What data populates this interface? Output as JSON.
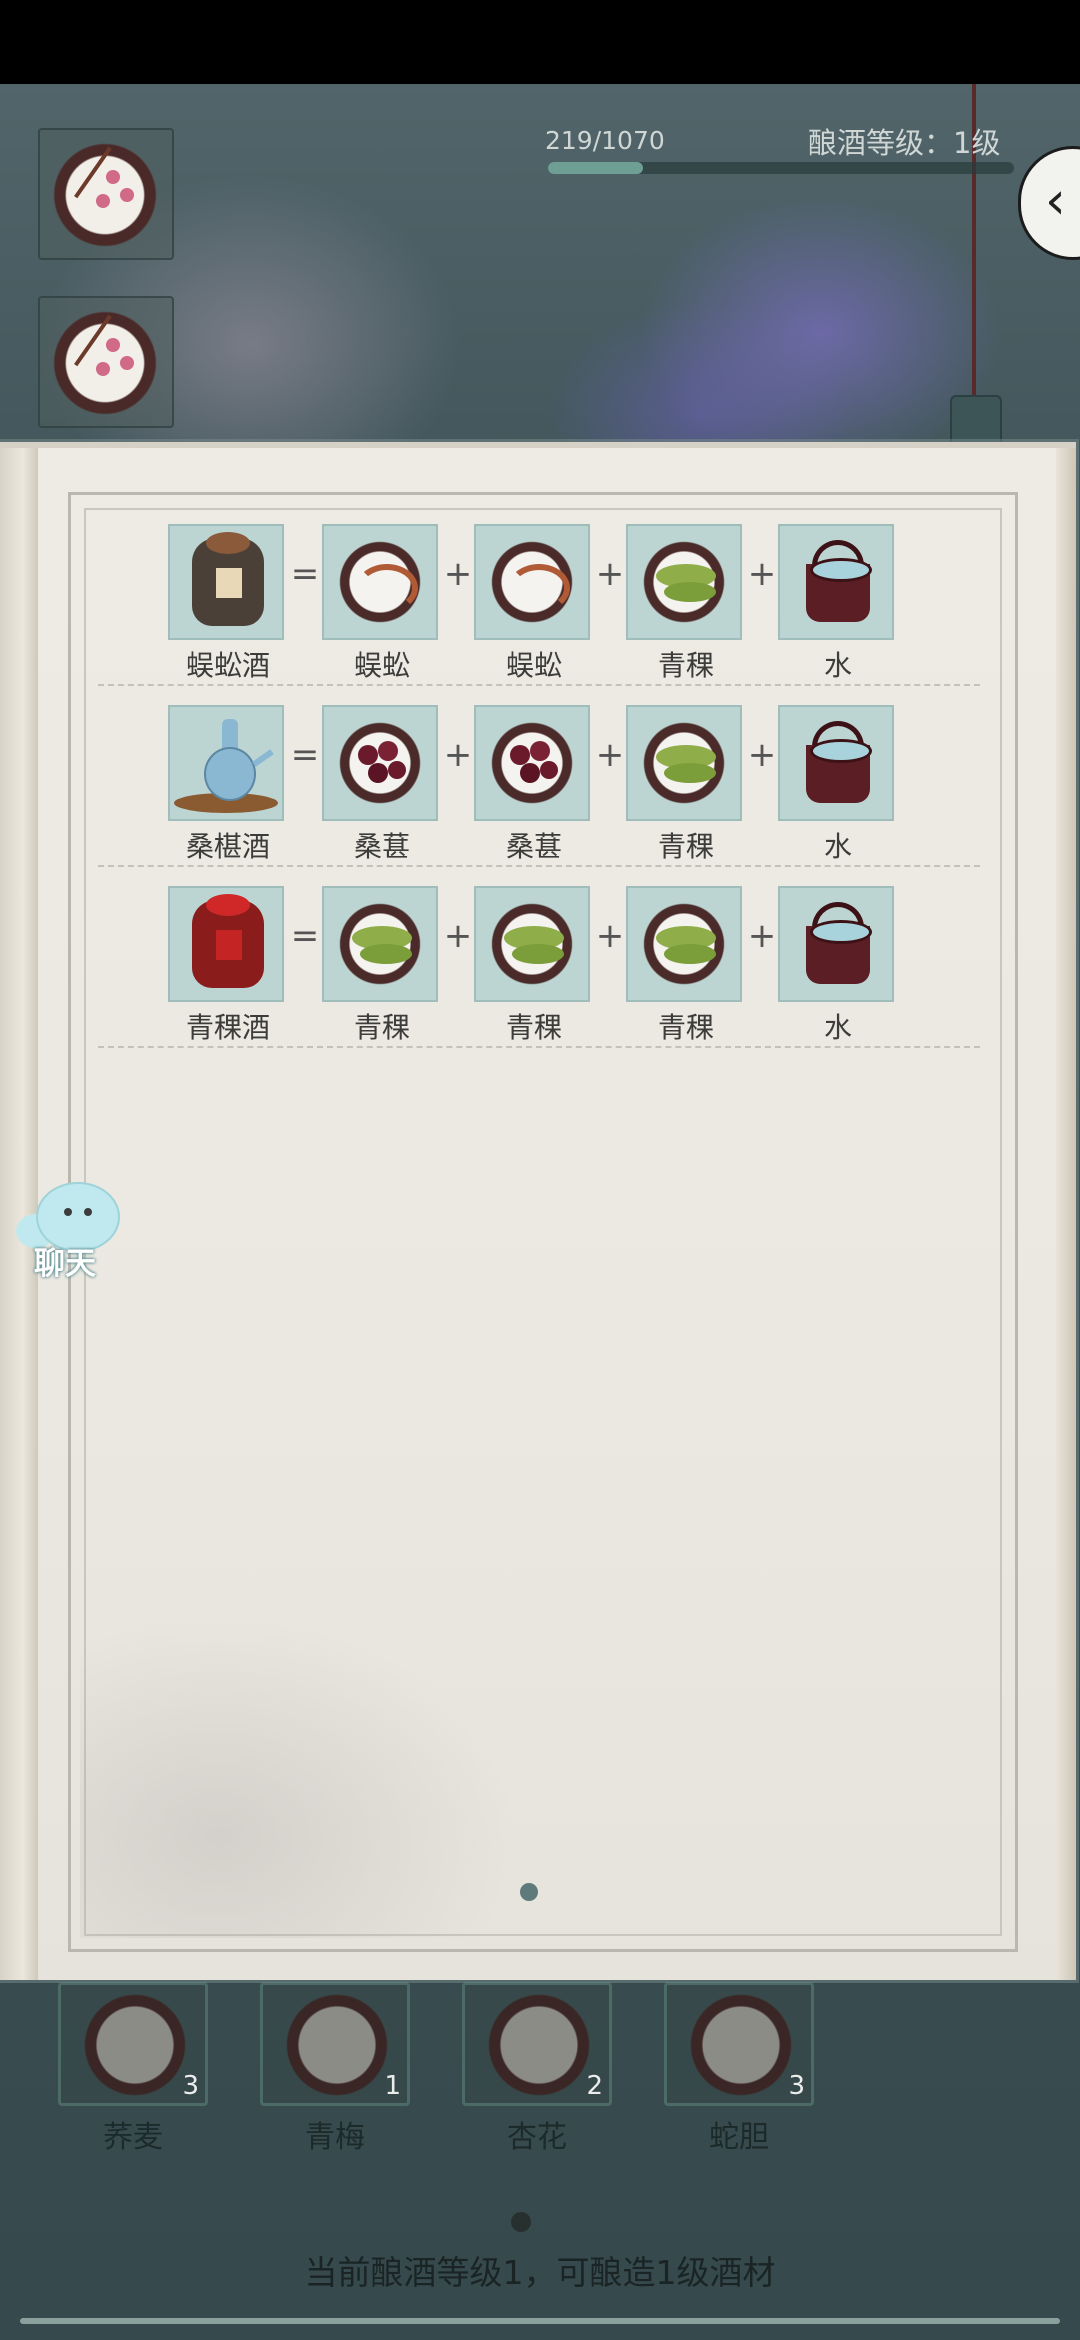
{
  "header": {
    "progress_text": "219/1070",
    "progress_value": 219,
    "progress_max": 1070,
    "level_text": "酿酒等级：1级",
    "back_icon": "chevron-left-icon"
  },
  "recipes": [
    {
      "result": "蜈蚣酒",
      "ingredients": [
        "蜈蚣",
        "蜈蚣",
        "青稞",
        "水"
      ]
    },
    {
      "result": "桑椹酒",
      "ingredients": [
        "桑葚",
        "桑葚",
        "青稞",
        "水"
      ]
    },
    {
      "result": "青稞酒",
      "ingredients": [
        "青稞",
        "青稞",
        "青稞",
        "水"
      ]
    }
  ],
  "operators": {
    "equals": "=",
    "plus": "+"
  },
  "chat": {
    "label": "聊天"
  },
  "inventory": {
    "items": [
      {
        "name": "荞麦",
        "count": "3"
      },
      {
        "name": "青梅",
        "count": "1"
      },
      {
        "name": "杏花",
        "count": "2"
      },
      {
        "name": "蛇胆",
        "count": "3"
      }
    ],
    "message": "当前酿酒等级1，可酿造1级酒材"
  },
  "colors": {
    "tile_bg": "#bcd4d2",
    "page_bg": "#eeebe4",
    "progress_fill": "#6e9e94"
  }
}
